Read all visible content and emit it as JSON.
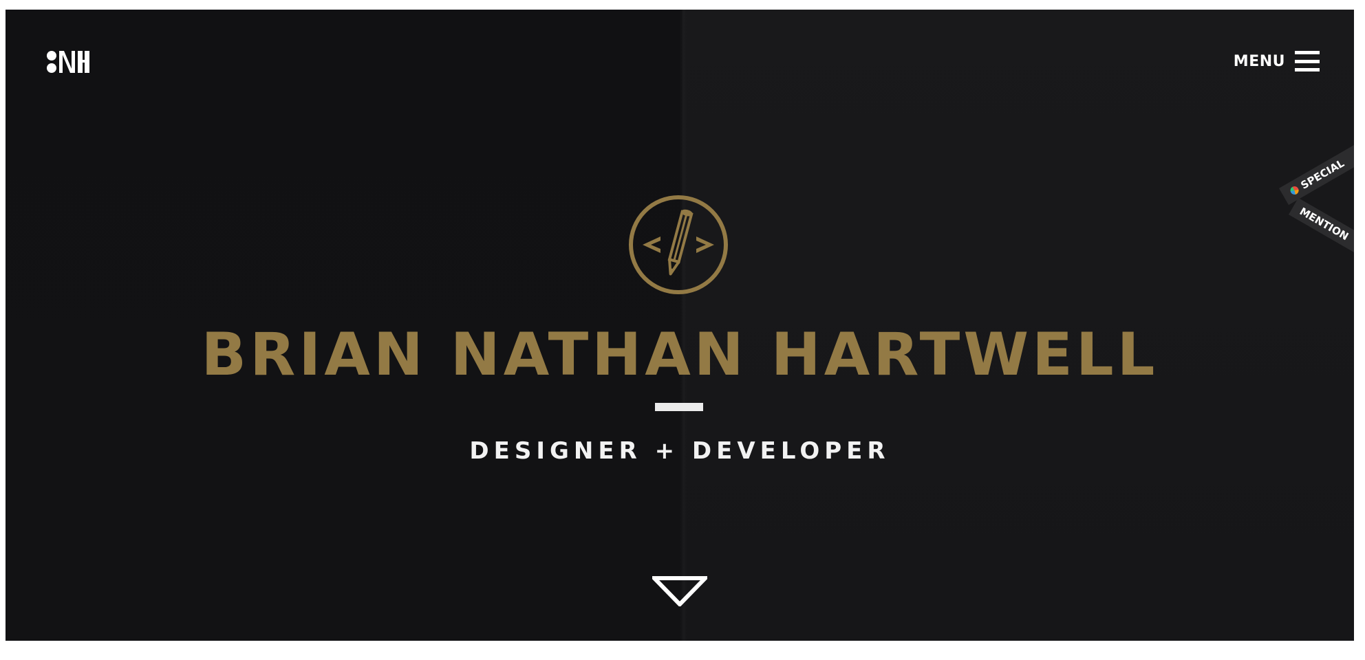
{
  "header": {
    "menu_label": "MENU"
  },
  "ribbon": {
    "line1": "SPECIAL",
    "line2": "MENTION"
  },
  "hero": {
    "name": "BRIAN NATHAN HARTWELL",
    "tagline": "DESIGNER + DEVELOPER"
  },
  "icons": {
    "logo": "bnh-monogram-logo",
    "emblem": "code-pencil-icon",
    "menu": "hamburger-icon",
    "scroll": "down-triangle-icon",
    "award": "award-badge-icon"
  },
  "colors": {
    "background": "#151517",
    "gold": "#937a45",
    "text": "#ffffff"
  }
}
